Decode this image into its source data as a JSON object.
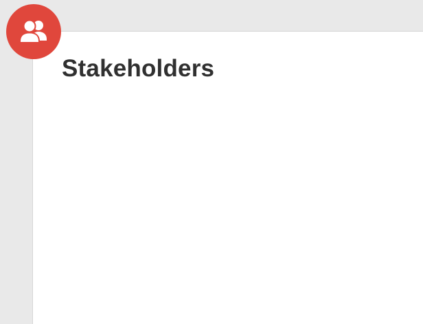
{
  "header": {
    "icon": "people-icon",
    "icon_color": "#e0473c",
    "title": "Stakeholders"
  },
  "colors": {
    "background": "#e9e9e9",
    "card": "#ffffff",
    "title_text": "#303030"
  }
}
